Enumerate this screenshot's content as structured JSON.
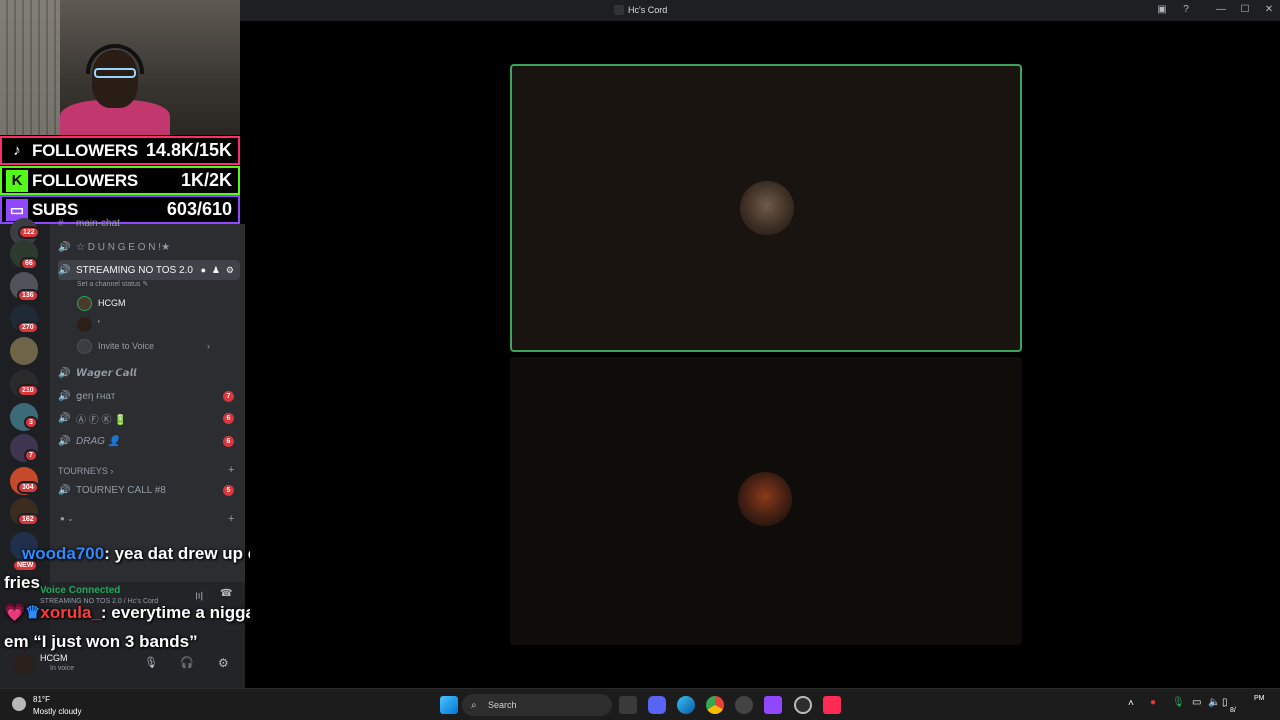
{
  "window": {
    "title": "Hc's Cord"
  },
  "overlay": {
    "tiktok": {
      "label": "FOLLOWERS",
      "value": "14.8K/15K"
    },
    "kick": {
      "label": "FOLLOWERS",
      "value": "1K/2K"
    },
    "twitch": {
      "label": "SUBS",
      "value": "603/610"
    }
  },
  "servers": {
    "badges": [
      "122",
      "66",
      "136",
      "270",
      "210",
      "3",
      "7",
      "304",
      "162"
    ],
    "new_label": "NEW"
  },
  "channels": {
    "top_partial": "main-chat",
    "dungeon": "☆ D U N G E O N !★",
    "streaming": "STREAMING NO TOS 2.0",
    "channel_status": "Set a channel status",
    "members": [
      {
        "name": "HCGM"
      },
      {
        "name": "'"
      }
    ],
    "invite": "Invite to Voice",
    "wager": "𝙒𝙖𝙜𝙚𝙧 𝘾𝙖𝙡𝙡",
    "gen_chat": "ցеη ғнат",
    "gen_chat_badge": "7",
    "afk": "Ⓐ Ⓕ Ⓚ 🔋",
    "afk_badge": "6",
    "drag": "DRAG 👤",
    "drag_badge": "6",
    "tourneys_category": "TOURNEYS",
    "tourney_call": "TOURNEY CALL #8",
    "tourney_badge": "5"
  },
  "voice": {
    "status": "Voice Connected",
    "location": "STREAMING NO TOS 2.0 / Hc's Cord"
  },
  "user": {
    "name": "HCGM",
    "status": "In voice"
  },
  "chat": [
    {
      "user": "wooda700",
      "text": ": yea dat drew up character shi",
      "cont": "fries"
    },
    {
      "user": "xorula_",
      "text": ": everytime a nigga say some to",
      "cont": "em “I just won 3 bands”"
    }
  ],
  "taskbar": {
    "temp": "81°F",
    "weather": "Mostly cloudy",
    "search_placeholder": "Search",
    "time": "PM",
    "date": "8/"
  },
  "colors": {
    "tiktok": "#ff2c6b",
    "kick": "#53fc18",
    "twitch": "#9146ff",
    "speaking": "#3ba55d",
    "badge": "#da373c"
  }
}
